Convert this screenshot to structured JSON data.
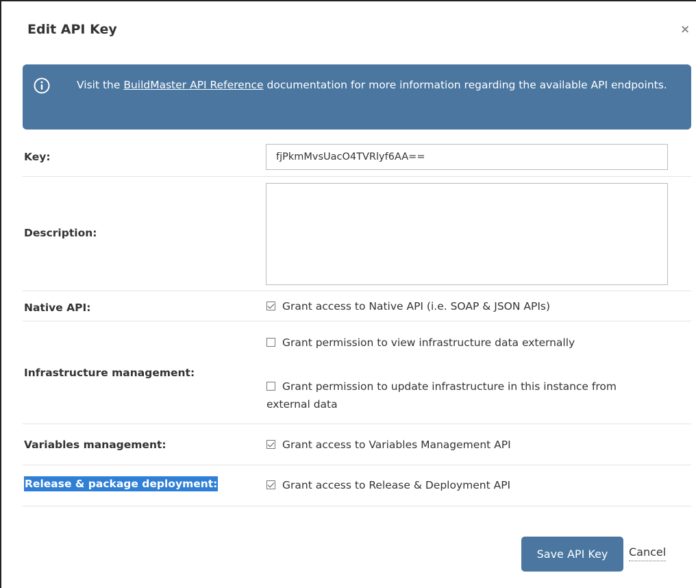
{
  "dialog": {
    "title": "Edit API Key",
    "close_icon": "×"
  },
  "info": {
    "icon": "info-circle-icon",
    "text_before": "Visit the ",
    "link_text": "BuildMaster API Reference",
    "text_after": " documentation for more information regarding the available API endpoints.",
    "background": "#4a76a0"
  },
  "form": {
    "key": {
      "label": "Key:",
      "value": "fjPkmMvsUacO4TVRlyf6AA=="
    },
    "description": {
      "label": "Description:",
      "value": ""
    },
    "native_api": {
      "label": "Native API:",
      "option": "Grant access to Native API (i.e. SOAP & JSON APIs)",
      "checked": true
    },
    "infrastructure": {
      "label": "Infrastructure management:",
      "option_view": "Grant permission to view infrastructure data externally",
      "option_view_checked": false,
      "option_update": "Grant permission to update infrastructure in this instance from external data",
      "option_update_checked": false
    },
    "variables": {
      "label": "Variables management:",
      "option": "Grant access to Variables Management API",
      "checked": true
    },
    "release": {
      "label": "Release & package deployment:",
      "option": "Grant access to Release & Deployment API",
      "checked": true
    }
  },
  "actions": {
    "save_label": "Save API Key",
    "cancel_label": "Cancel"
  },
  "colors": {
    "accent": "#4a76a0",
    "selection_highlight": "#2f7fd6"
  }
}
